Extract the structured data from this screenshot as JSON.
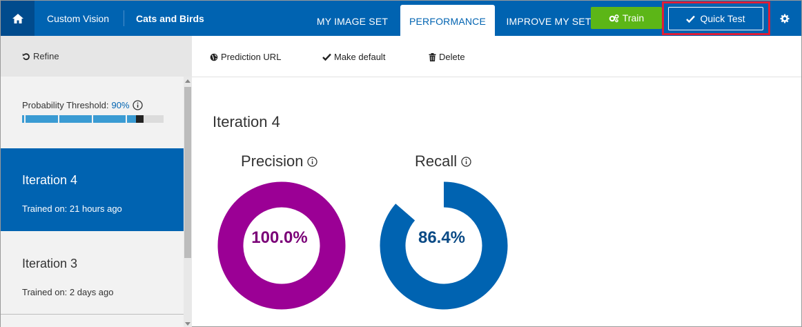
{
  "header": {
    "brand": "Custom Vision",
    "project": "Cats and Birds",
    "tabs": [
      {
        "label": "MY IMAGE SET"
      },
      {
        "label": "PERFORMANCE"
      },
      {
        "label": "IMPROVE MY SET"
      }
    ],
    "train_label": "Train",
    "quick_test_label": "Quick Test"
  },
  "sidebar": {
    "refine_label": "Refine",
    "threshold_label": "Probability Threshold:",
    "threshold_value": "90%",
    "threshold_fraction": 0.9,
    "iterations": [
      {
        "name": "Iteration 4",
        "trained": "Trained on: 21 hours ago"
      },
      {
        "name": "Iteration 3",
        "trained": "Trained on: 2 days ago"
      }
    ]
  },
  "toolbar": {
    "prediction_url": "Prediction URL",
    "make_default": "Make default",
    "delete": "Delete"
  },
  "main": {
    "iteration_title": "Iteration 4",
    "precision_label": "Precision",
    "recall_label": "Recall",
    "precision_value": "100.0%",
    "recall_value": "86.4%",
    "precision_fraction": 1.0,
    "recall_fraction": 0.864
  },
  "colors": {
    "accent": "#0063b1",
    "train": "#5cb617",
    "precision": "#9b0095",
    "recall": "#0063b1",
    "highlight": "#e01e37"
  }
}
